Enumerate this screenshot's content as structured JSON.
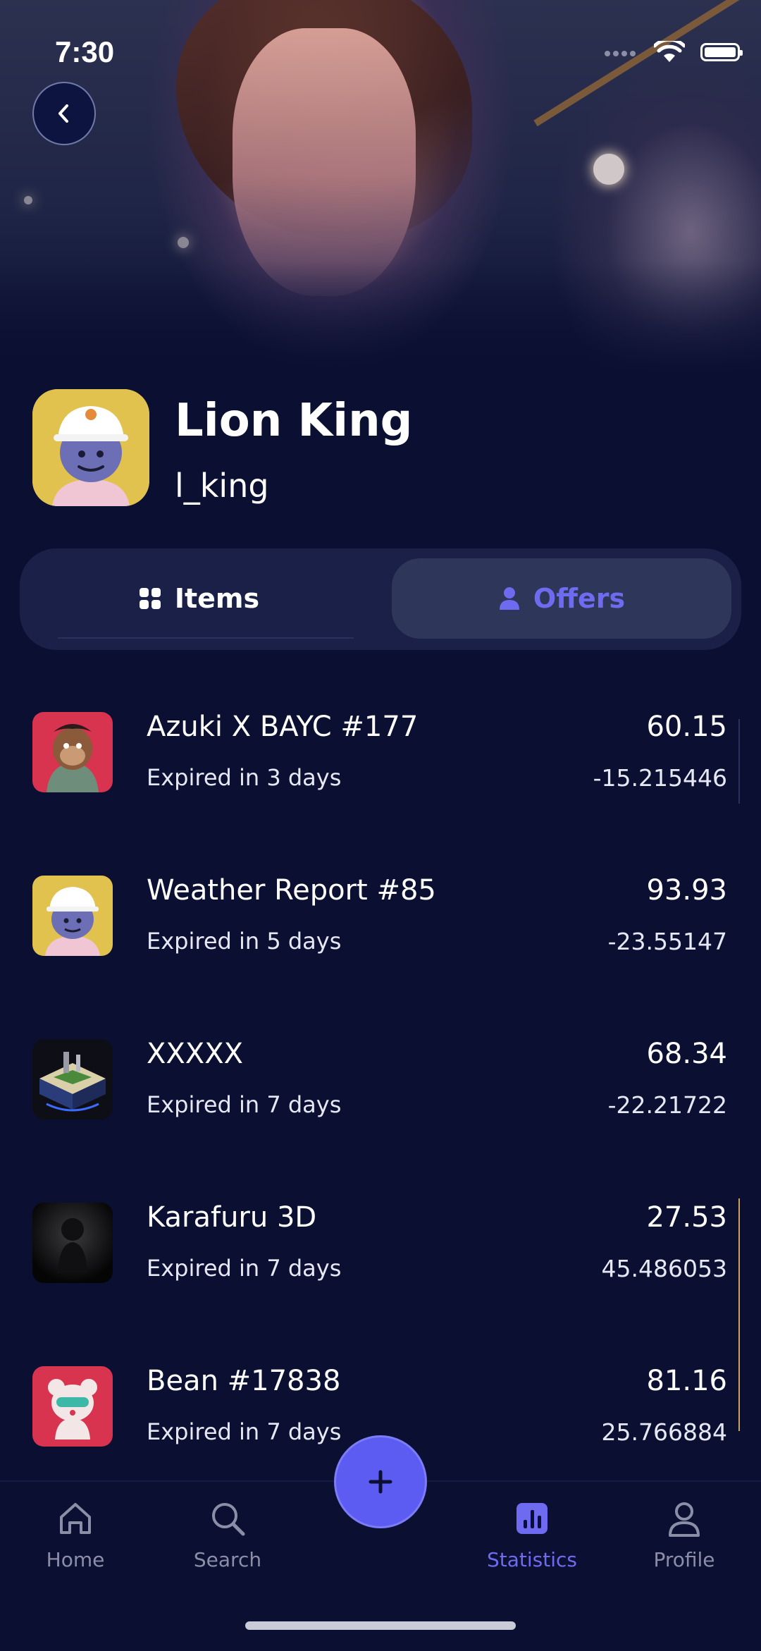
{
  "status_bar": {
    "time": "7:30"
  },
  "profile": {
    "name": "Lion King",
    "handle": "l_king"
  },
  "tabs": [
    {
      "label": "Items",
      "icon": "grid-icon",
      "active": false
    },
    {
      "label": "Offers",
      "icon": "person-icon",
      "active": true
    }
  ],
  "offers": [
    {
      "name": "Azuki X BAYC #177",
      "expiry": "Expired in 3 days",
      "price": "60.15",
      "change": "-15.215446",
      "thumb": "ape-art"
    },
    {
      "name": "Weather Report #85",
      "expiry": "Expired in 5 days",
      "price": "93.93",
      "change": "-23.55147",
      "thumb": "helmet-avatar"
    },
    {
      "name": "XXXXX",
      "expiry": "Expired in 7 days",
      "price": "68.34",
      "change": "-22.21722",
      "thumb": "island-art"
    },
    {
      "name": "Karafuru 3D",
      "expiry": "Expired in 7 days",
      "price": "27.53",
      "change": "45.486053",
      "thumb": "dark-figure"
    },
    {
      "name": "Bean #17838",
      "expiry": "Expired in 7 days",
      "price": "81.16",
      "change": "25.766884",
      "thumb": "bear-art"
    }
  ],
  "bottom_nav": [
    {
      "label": "Home",
      "icon": "home-icon",
      "active": false
    },
    {
      "label": "Search",
      "icon": "search-icon",
      "active": false
    },
    {
      "label": "Statistics",
      "icon": "chart-icon",
      "active": true
    },
    {
      "label": "Profile",
      "icon": "profile-icon",
      "active": false
    }
  ],
  "fab": {
    "icon": "plus-icon"
  },
  "colors": {
    "background": "#0b1033",
    "accent": "#5c5bf2",
    "active_text": "#6e6bf0",
    "inactive_text": "#8a8ea6"
  }
}
